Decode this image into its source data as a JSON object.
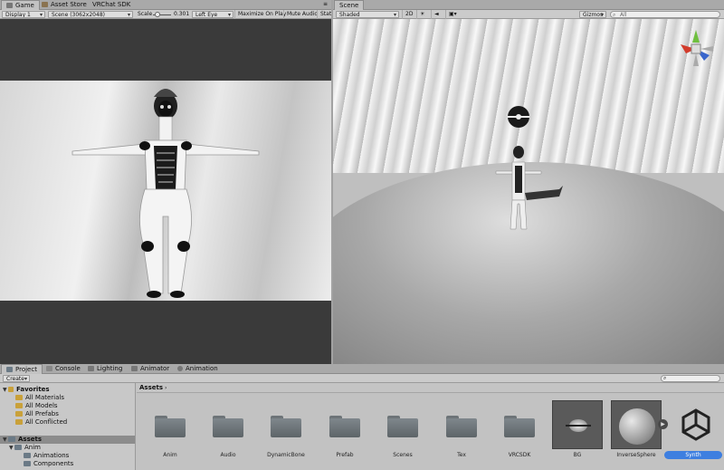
{
  "game": {
    "tabs": [
      {
        "label": "Game",
        "icon": "gamepad-icon"
      },
      {
        "label": "Asset Store",
        "icon": "store-icon"
      },
      {
        "label": "VRChat SDK",
        "icon": ""
      }
    ],
    "toolbar": {
      "display": "Display 1",
      "resolution": "Scene (3062x2048)",
      "scale_label": "Scale",
      "scale_value": "0.301",
      "eye": "Left Eye",
      "maximize": "Maximize On Play",
      "mute": "Mute Audio",
      "stats": "Stat"
    }
  },
  "scene": {
    "tab": "Scene",
    "toolbar": {
      "shading": "Shaded",
      "mode_2d": "2D",
      "gizmos": "Gizmos",
      "search_placeholder": "All"
    }
  },
  "bottom": {
    "tabs": [
      {
        "label": "Project",
        "icon": "folder-icon"
      },
      {
        "label": "Console",
        "icon": "console-icon"
      },
      {
        "label": "Lighting",
        "icon": "lighting-icon"
      },
      {
        "label": "Animator",
        "icon": "animator-icon"
      },
      {
        "label": "Animation",
        "icon": "animation-icon"
      }
    ],
    "create": "Create",
    "tree": {
      "favorites": "Favorites",
      "fav_items": [
        "All Materials",
        "All Models",
        "All Prefabs",
        "All Conflicted"
      ],
      "assets": "Assets",
      "children": [
        "Anim",
        "Animations",
        "Components"
      ]
    },
    "breadcrumb": "Assets",
    "folders": [
      "Anim",
      "Audio",
      "DynamicBone",
      "Prefab",
      "Scenes",
      "Tex",
      "VRCSDK"
    ],
    "assets": [
      "BG",
      "InverseSphere",
      "Synth"
    ],
    "colors": {
      "selected": "#3e7fe0",
      "folder_tree_selected": "#8c8c8c"
    }
  }
}
